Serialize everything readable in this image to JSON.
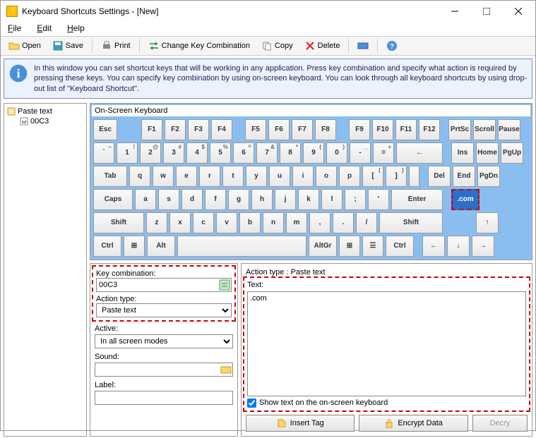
{
  "window": {
    "title": "Keyboard Shortcuts Settings - [New]"
  },
  "menu": {
    "file": "File",
    "edit": "Edit",
    "help": "Help"
  },
  "toolbar": {
    "open": "Open",
    "save": "Save",
    "print": "Print",
    "change": "Change Key Combination",
    "copy": "Copy",
    "delete": "Delete"
  },
  "info": "In this window you can set shortcut keys that will be working in any application. Press key combination and specify what action is required by pressing these keys. You can specify key combination by using on-screen keyboard. You can look through all keyboard shortcuts by using drop-out list of \"Keyboard Shortcut\".",
  "tree": {
    "root": "Paste text",
    "child": "00C3"
  },
  "osk": {
    "title": "On-Screen Keyboard",
    "selected": ".com",
    "row0": [
      "Esc",
      "F1",
      "F2",
      "F3",
      "F4",
      "F5",
      "F6",
      "F7",
      "F8",
      "F9",
      "F10",
      "F11",
      "F12",
      "PrtSc",
      "Scroll",
      "Pause"
    ],
    "row1_main": [
      "`",
      "1",
      "2",
      "3",
      "4",
      "5",
      "6",
      "7",
      "8",
      "9",
      "0",
      "-",
      "=",
      "←"
    ],
    "row1_sub": [
      "~",
      "!",
      "@",
      "#",
      "$",
      "%",
      "^",
      "&",
      "*",
      "(",
      ")",
      "_",
      "+",
      ""
    ],
    "row1_side": [
      "Ins",
      "Home",
      "PgUp"
    ],
    "row2_main": [
      "Tab",
      "q",
      "w",
      "e",
      "r",
      "t",
      "y",
      "u",
      "i",
      "o",
      "p",
      "[",
      "]"
    ],
    "row2_sub": [
      "",
      "",
      "",
      "",
      "",
      "",
      "",
      "",
      "",
      "",
      "",
      "{",
      "}"
    ],
    "row2_side": [
      "Del",
      "End",
      "PgDn"
    ],
    "row3_main": [
      "Caps",
      "a",
      "s",
      "d",
      "f",
      "g",
      "h",
      "j",
      "k",
      "l",
      ";",
      "'",
      "Enter"
    ],
    "row4_main": [
      "Shift",
      "z",
      "x",
      "c",
      "v",
      "b",
      "n",
      "m",
      ",",
      ".",
      "/",
      "Shift"
    ],
    "row4_side": [
      "↑"
    ],
    "row5_main": [
      "Ctrl",
      "⊞",
      "Alt",
      "",
      "AltGr",
      "⊞",
      "☰",
      "Ctrl"
    ],
    "row5_side": [
      "←",
      "↓",
      "→"
    ]
  },
  "form": {
    "keycomb_label": "Key combination:",
    "keycomb_value": "00C3",
    "atype_label": "Action type:",
    "atype_value": "Paste text",
    "active_label": "Active:",
    "active_value": "In all screen modes",
    "sound_label": "Sound:",
    "sound_value": "",
    "label_label": "Label:",
    "label_value": ""
  },
  "action": {
    "header": "Action type : Paste text",
    "text_label": "Text:",
    "text_value": ".com",
    "showtext": "Show text on the on-screen keyboard",
    "insert": "Insert Tag",
    "encrypt": "Encrypt Data",
    "decrypt": "Decry"
  }
}
